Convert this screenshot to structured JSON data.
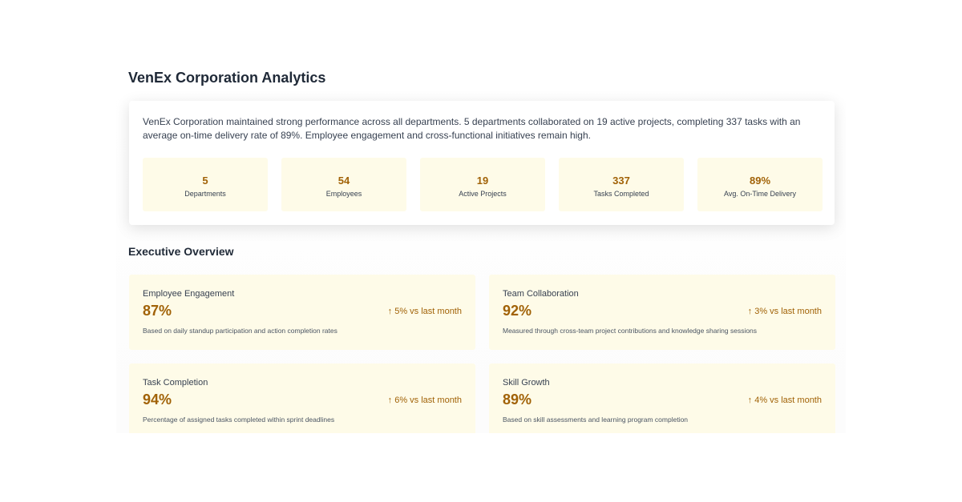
{
  "page": {
    "title": "VenEx Corporation Analytics"
  },
  "summary": {
    "text": "VenEx Corporation maintained strong performance across all departments. 5 departments collaborated on 19 active projects, completing 337 tasks with an average on-time delivery rate of 89%. Employee engagement and cross-functional initiatives remain high.",
    "stats": [
      {
        "value": "5",
        "label": "Departments"
      },
      {
        "value": "54",
        "label": "Employees"
      },
      {
        "value": "19",
        "label": "Active Projects"
      },
      {
        "value": "337",
        "label": "Tasks Completed"
      },
      {
        "value": "89%",
        "label": "Avg. On-Time Delivery"
      }
    ]
  },
  "overview": {
    "title": "Executive Overview",
    "metrics": [
      {
        "name": "Employee Engagement",
        "value": "87%",
        "change": "↑ 5% vs last month",
        "description": "Based on daily standup participation and action completion rates"
      },
      {
        "name": "Team Collaboration",
        "value": "92%",
        "change": "↑ 3% vs last month",
        "description": "Measured through cross-team project contributions and knowledge sharing sessions"
      },
      {
        "name": "Task Completion",
        "value": "94%",
        "change": "↑ 6% vs last month",
        "description": "Percentage of assigned tasks completed within sprint deadlines"
      },
      {
        "name": "Skill Growth",
        "value": "89%",
        "change": "↑ 4% vs last month",
        "description": "Based on skill assessments and learning program completion"
      }
    ]
  },
  "colors": {
    "accent": "#a16207",
    "card_bg": "#fefbe8"
  }
}
